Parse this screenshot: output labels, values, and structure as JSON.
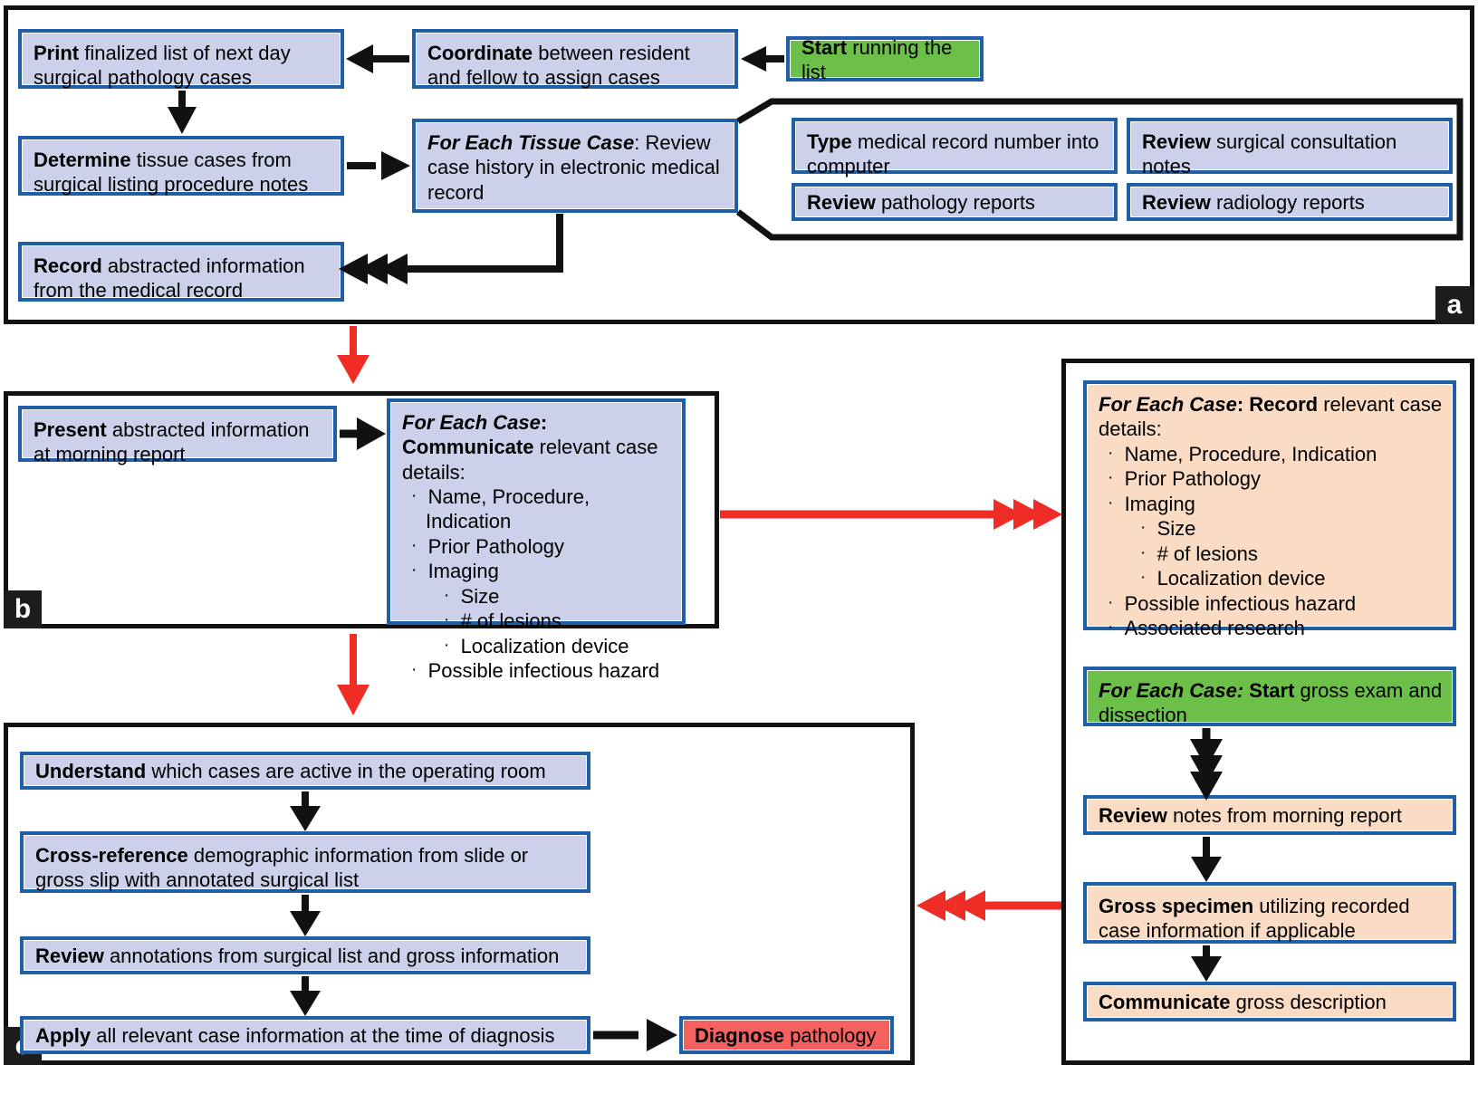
{
  "figure": {
    "type": "flowchart",
    "panels": [
      {
        "id": "a",
        "label": "a"
      },
      {
        "id": "b",
        "label": "b"
      },
      {
        "id": "c",
        "label": "c"
      }
    ],
    "colors": {
      "process_blue": "#ccd0ea",
      "record_peach": "#f9dcc3",
      "start_green": "#6cc04a",
      "end_red": "#f4615f",
      "box_border": "#1f5fa8",
      "panel_border": "#111111",
      "black_arrow": "#111111",
      "red_arrow": "#ef2d26"
    }
  },
  "panel_a": {
    "label": "a",
    "boxes": {
      "start": {
        "lead": "Start",
        "rest": " running the list",
        "style": "green"
      },
      "coordinate": {
        "lead": "Coordinate",
        "rest": " between resident and fellow to assign cases",
        "style": "blue"
      },
      "print": {
        "lead": "Print",
        "rest": " finalized list of next day surgical pathology cases",
        "style": "blue"
      },
      "determine": {
        "lead": "Determine",
        "rest": " tissue cases from surgical listing procedure notes",
        "style": "blue"
      },
      "for_each_tissue_case": {
        "italic": "For Each Tissue Case",
        "rest": ": Review case history in electronic medical record",
        "style": "blue"
      },
      "record": {
        "lead": "Record",
        "rest": " abstracted information from the medical record",
        "style": "blue"
      },
      "sub_type": {
        "lead": "Type",
        "rest": " medical record number into computer",
        "style": "blue"
      },
      "sub_review_consult": {
        "lead": "Review",
        "rest": " surgical consultation notes",
        "style": "blue"
      },
      "sub_review_path": {
        "lead": "Review",
        "rest": " pathology reports",
        "style": "blue"
      },
      "sub_review_rad": {
        "lead": "Review",
        "rest": " radiology reports",
        "style": "blue"
      }
    }
  },
  "panel_b": {
    "label": "b",
    "boxes": {
      "present": {
        "lead": "Present",
        "rest": " abstracted information at morning report",
        "style": "blue"
      },
      "for_each_case_communicate": {
        "italic": "For Each Case",
        "bold": ": Communicate",
        "rest": " relevant case details:",
        "style": "blue",
        "bullets_l1": [
          "Name, Procedure, Indication",
          "Prior Pathology",
          "Imaging"
        ],
        "bullets_l2": [
          "Size",
          "# of lesions",
          "Localization device"
        ],
        "bullets_l1_tail": [
          "Possible infectious hazard"
        ]
      }
    }
  },
  "panel_c": {
    "label": "c",
    "boxes": {
      "understand": {
        "lead": "Understand",
        "rest": " which cases are active in the operating room",
        "style": "blue"
      },
      "cross_reference": {
        "lead": "Cross-reference",
        "rest": " demographic information from slide or gross slip with annotated surgical list",
        "style": "blue"
      },
      "review_annotations": {
        "lead": "Review",
        "rest": " annotations from surgical list and gross information",
        "style": "blue"
      },
      "apply": {
        "lead": "Apply",
        "rest": " all relevant case information at the time of diagnosis",
        "style": "blue"
      },
      "diagnose": {
        "lead": "Diagnose",
        "rest": " pathology",
        "style": "red"
      }
    }
  },
  "panel_d": {
    "label": "",
    "boxes": {
      "for_each_case_record": {
        "italic": "For Each Case",
        "bold": ": Record",
        "rest": " relevant case details:",
        "style": "peach",
        "bullets_l1": [
          "Name, Procedure, Indication",
          "Prior Pathology",
          "Imaging"
        ],
        "bullets_l2": [
          "Size",
          "# of lesions",
          "Localization device"
        ],
        "bullets_l1_tail": [
          "Possible infectious hazard",
          "Associated research"
        ]
      },
      "start_gross": {
        "italic": "For Each Case:",
        "bold": " Start",
        "rest": " gross exam and dissection",
        "style": "green"
      },
      "review_notes": {
        "lead": "Review",
        "rest": " notes from morning report",
        "style": "peach"
      },
      "gross_specimen": {
        "lead": "Gross specimen",
        "rest": " utilizing recorded case information if applicable",
        "style": "peach"
      },
      "communicate_gross": {
        "lead": "Communicate",
        "rest": " gross description",
        "style": "peach"
      }
    }
  },
  "bullet_glyph": "·"
}
